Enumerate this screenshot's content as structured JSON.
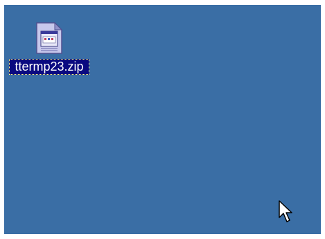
{
  "desktop": {
    "background_color": "#3a6ea5",
    "icons": [
      {
        "label": "ttermp23.zip",
        "icon": "zip-archive-icon",
        "selected": true
      }
    ]
  },
  "cursor": {
    "icon": "arrow-cursor-icon"
  }
}
